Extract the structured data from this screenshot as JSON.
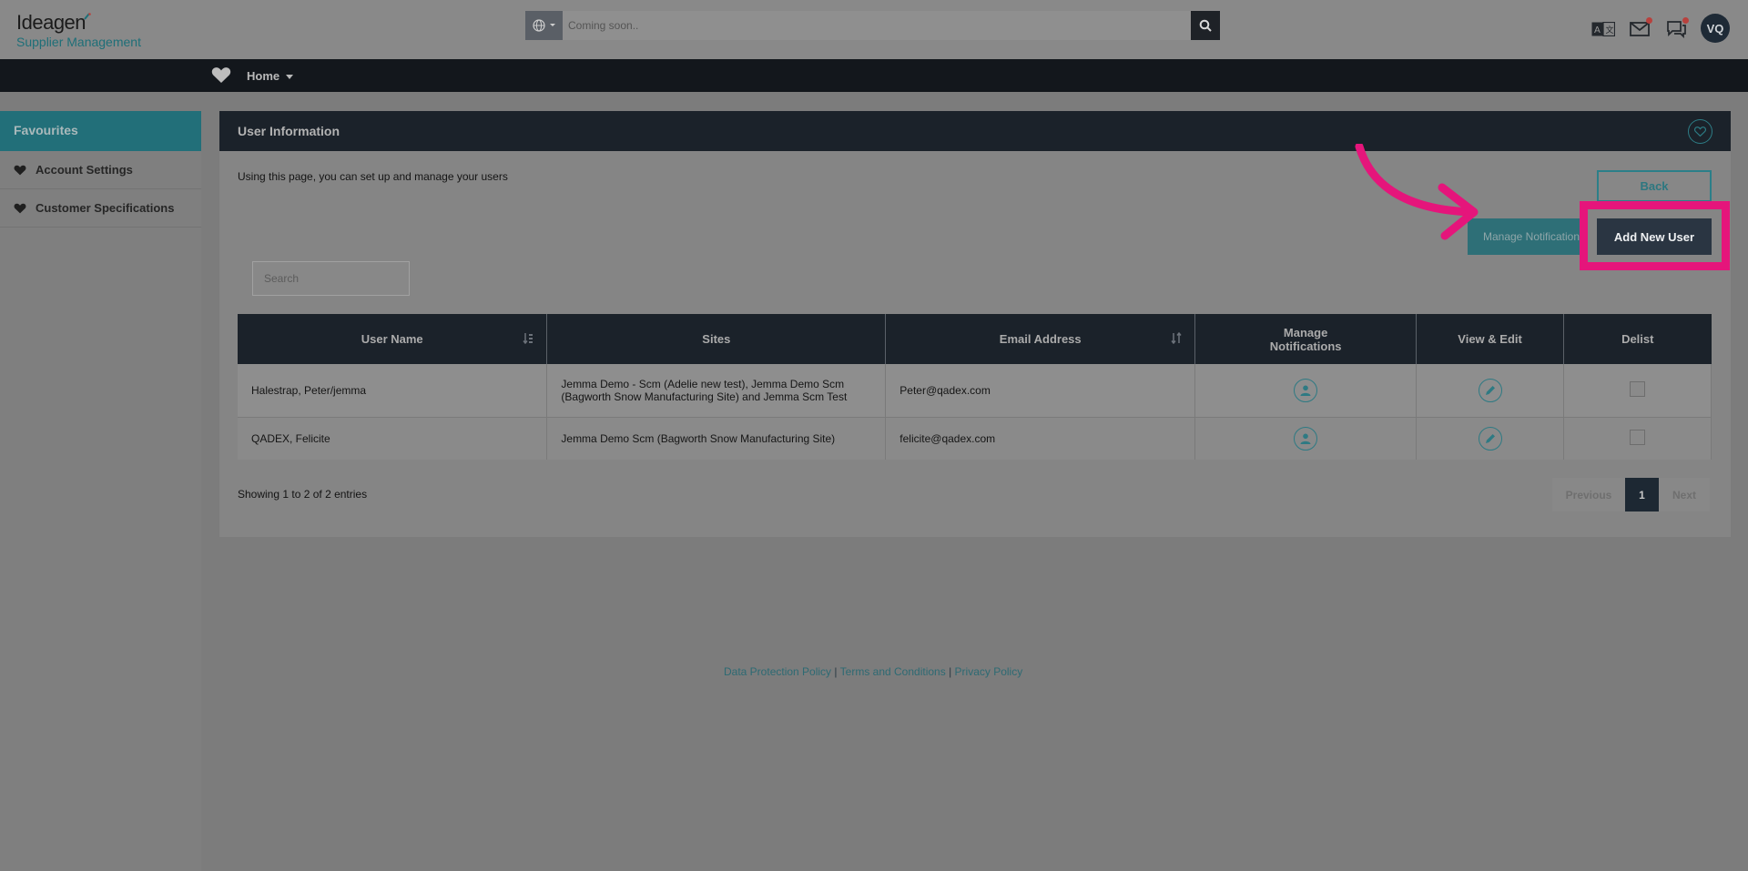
{
  "brand": {
    "name": "Ideagen",
    "product": "Supplier Management"
  },
  "topbar": {
    "search_placeholder": "Coming soon..",
    "avatar_initials": "VQ"
  },
  "nav": {
    "home_label": "Home"
  },
  "sidebar": {
    "header": "Favourites",
    "items": [
      {
        "label": "Account Settings"
      },
      {
        "label": "Customer Specifications"
      }
    ]
  },
  "panel": {
    "title": "User Information",
    "intro": "Using this page, you can set up and manage your users",
    "back_label": "Back",
    "manage_notifications_label": "Manage Notifications",
    "add_user_label": "Add New User",
    "search_placeholder": "Search"
  },
  "table": {
    "headers": {
      "user_name": "User Name",
      "sites": "Sites",
      "email": "Email Address",
      "manage_notifications_line1": "Manage",
      "manage_notifications_line2": "Notifications",
      "view_edit": "View & Edit",
      "delist": "Delist"
    },
    "rows": [
      {
        "user_name": "Halestrap, Peter/jemma",
        "sites_line1": "Jemma Demo - Scm (Adelie new test), Jemma Demo Scm",
        "sites_line2": "(Bagworth Snow Manufacturing Site) and Jemma Scm Test",
        "email": "Peter@qadex.com"
      },
      {
        "user_name": "QADEX, Felicite",
        "sites_line1": "Jemma Demo Scm (Bagworth Snow Manufacturing Site)",
        "sites_line2": "",
        "email": "felicite@qadex.com"
      }
    ]
  },
  "pagination": {
    "summary": "Showing 1 to 2 of 2 entries",
    "previous": "Previous",
    "current": "1",
    "next": "Next"
  },
  "footer": {
    "links": [
      "Data Protection Policy",
      "Terms and Conditions",
      "Privacy Policy"
    ],
    "separator": "|"
  },
  "colors": {
    "accent_teal": "#2b7f89",
    "highlight_pink": "#e5157b",
    "navbar": "#13171c"
  },
  "icons": {
    "search": "search-icon",
    "globe": "globe-icon",
    "translate": "translate-icon",
    "mail": "mail-icon",
    "chat": "chat-icon",
    "heart": "heart-icon",
    "user": "user-icon",
    "edit": "pencil-icon",
    "sort": "sort-icon"
  }
}
